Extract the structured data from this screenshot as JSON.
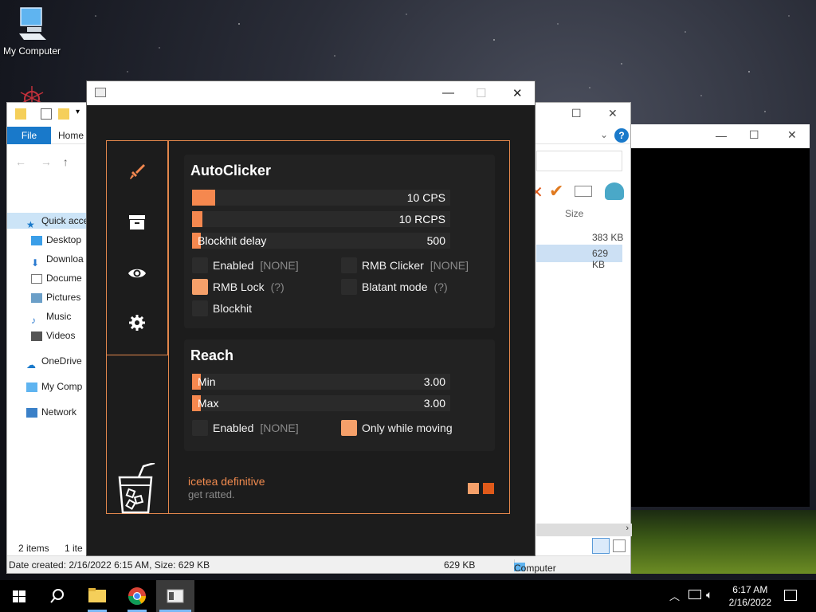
{
  "desktop": {
    "icons": [
      {
        "label": "My Computer",
        "icon": "computer-icon"
      }
    ]
  },
  "explorer": {
    "tabs": {
      "file": "File",
      "home": "Home"
    },
    "nav_items": [
      {
        "label": "Quick acce",
        "icon": "star-icon"
      },
      {
        "label": "Desktop",
        "icon": "desktop-icon"
      },
      {
        "label": "Downloa",
        "icon": "download-icon"
      },
      {
        "label": "Docume",
        "icon": "document-icon"
      },
      {
        "label": "Pictures",
        "icon": "pictures-icon"
      },
      {
        "label": "Music",
        "icon": "music-icon"
      },
      {
        "label": "Videos",
        "icon": "videos-icon"
      },
      {
        "label": "OneDrive",
        "icon": "cloud-icon"
      },
      {
        "label": "My Comp",
        "icon": "computer-icon"
      },
      {
        "label": "Network",
        "icon": "network-icon"
      }
    ],
    "column_size": "Size",
    "file_sizes": [
      "383 KB",
      "629 KB"
    ],
    "status": {
      "items": "2 items",
      "selected": "1 ite",
      "details": "Date created: 2/16/2022 6:15 AM, Size: 629 KB",
      "size": "629 KB",
      "location": "Computer"
    }
  },
  "app": {
    "autoclicker": {
      "title": "AutoClicker",
      "sliders": [
        {
          "label": "",
          "value": "10 CPS",
          "fill": 0.09
        },
        {
          "label": "",
          "value": "10 RCPS",
          "fill": 0.04
        },
        {
          "label": "Blockhit delay",
          "value": "500",
          "fill": 0.02
        }
      ],
      "options": [
        {
          "label": "Enabled",
          "key": "[NONE]",
          "on": false
        },
        {
          "label": "RMB Clicker",
          "key": "[NONE]",
          "on": false
        },
        {
          "label": "RMB Lock",
          "key": "(?)",
          "on": true
        },
        {
          "label": "Blatant mode",
          "key": "(?)",
          "on": false
        },
        {
          "label": "Blockhit",
          "key": "",
          "on": false
        }
      ]
    },
    "reach": {
      "title": "Reach",
      "sliders": [
        {
          "label": "Min",
          "value": "3.00",
          "fill": 0.02
        },
        {
          "label": "Max",
          "value": "3.00",
          "fill": 0.02
        }
      ],
      "options": [
        {
          "label": "Enabled",
          "key": "[NONE]",
          "on": false
        },
        {
          "label": "Only while moving",
          "key": "",
          "on": true
        }
      ]
    },
    "footer": {
      "title": "icetea definitive",
      "subtitle": "get ratted."
    },
    "colors": {
      "accent": "#f5884f",
      "accent_dark": "#e05a1a",
      "bg": "#1c1c1c"
    }
  },
  "taskbar": {
    "time": "6:17 AM",
    "date": "2/16/2022"
  }
}
